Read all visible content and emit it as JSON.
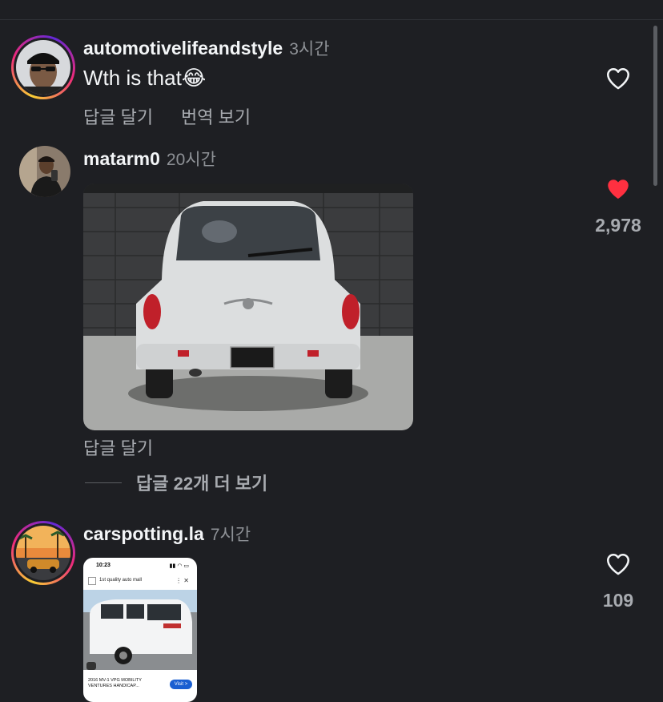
{
  "comments": [
    {
      "username": "automotivelifeandstyle",
      "time": "3시간",
      "text": "Wth is that😂",
      "reply_label": "답글 달기",
      "translate_label": "번역 보기",
      "liked": false
    },
    {
      "username": "matarm0",
      "time": "20시간",
      "reply_label": "답글 달기",
      "likes": "2,978",
      "liked": true,
      "view_replies_label": "답글 22개 더 보기"
    },
    {
      "username": "carspotting.la",
      "time": "7시간",
      "likes": "109",
      "liked": false,
      "screenshot": {
        "clock": "10:23",
        "search_text": "1st quality auto mall",
        "caption": "2016 MV-1 VPG MOBILITY VENTURES HANDICAP...",
        "visit_label": "Visit >"
      }
    }
  ],
  "colors": {
    "background": "#1e1f23",
    "liked_heart": "#ff3040",
    "secondary_text": "#a8abb0"
  }
}
